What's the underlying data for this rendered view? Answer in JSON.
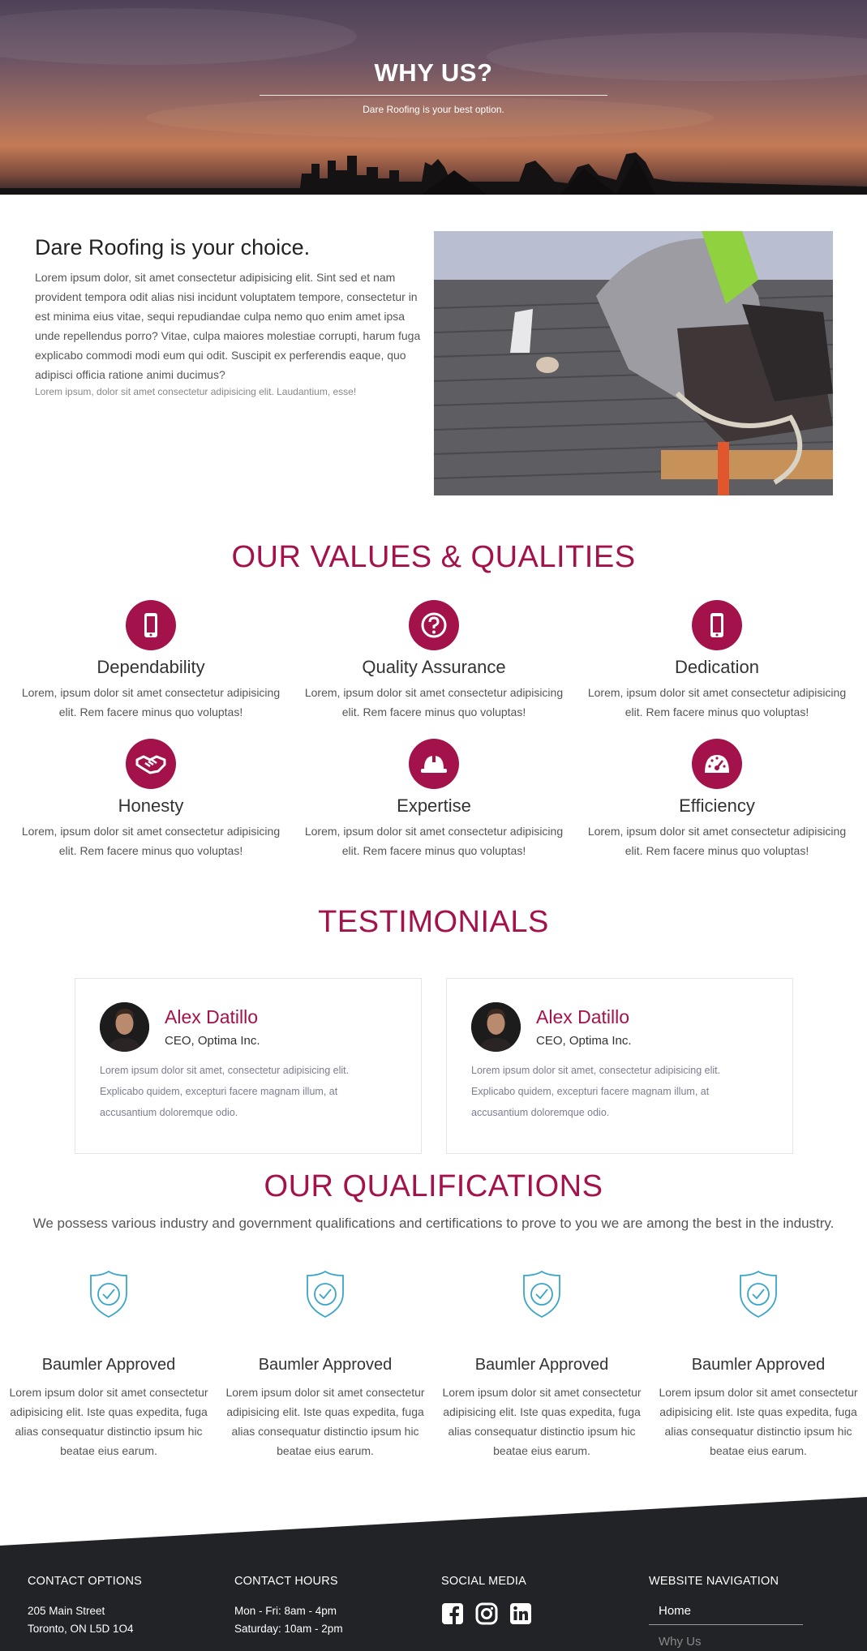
{
  "hero": {
    "title": "WHY US?",
    "subtitle": "Dare Roofing is your best option."
  },
  "choice": {
    "title": "Dare Roofing is your choice.",
    "text": "Lorem ipsum dolor, sit amet consectetur adipisicing elit. Sint sed et nam provident tempora odit alias nisi incidunt voluptatem tempore, consectetur in est minima eius vitae, sequi repudiandae culpa nemo quo enim amet ipsa unde repellendus porro? Vitae, culpa maiores molestiae corrupti, harum fuga explicabo commodi modi eum qui odit. Suscipit ex perferendis eaque, quo adipisci officia ratione animi ducimus?",
    "small": "Lorem ipsum, dolor sit amet consectetur adipisicing elit. Laudantium, esse!"
  },
  "values": {
    "title": "OUR VALUES & QUALITIES",
    "items": [
      {
        "icon": "mobile-phone-icon",
        "title": "Dependability",
        "text": "Lorem, ipsum dolor sit amet consectetur adipisicing elit. Rem facere minus quo voluptas!"
      },
      {
        "icon": "question-circle-icon",
        "title": "Quality Assurance",
        "text": "Lorem, ipsum dolor sit amet consectetur adipisicing elit. Rem facere minus quo voluptas!"
      },
      {
        "icon": "mobile-phone-icon",
        "title": "Dedication",
        "text": "Lorem, ipsum dolor sit amet consectetur adipisicing elit. Rem facere minus quo voluptas!"
      },
      {
        "icon": "handshake-icon",
        "title": "Honesty",
        "text": "Lorem, ipsum dolor sit amet consectetur adipisicing elit. Rem facere minus quo voluptas!"
      },
      {
        "icon": "hard-hat-icon",
        "title": "Expertise",
        "text": "Lorem, ipsum dolor sit amet consectetur adipisicing elit. Rem facere minus quo voluptas!"
      },
      {
        "icon": "speedometer-icon",
        "title": "Efficiency",
        "text": "Lorem, ipsum dolor sit amet consectetur adipisicing elit. Rem facere minus quo voluptas!"
      }
    ]
  },
  "testimonials": {
    "title": "TESTIMONIALS",
    "items": [
      {
        "name": "Alex Datillo",
        "role": "CEO, Optima Inc.",
        "text": "Lorem ipsum dolor sit amet, consectetur adipisicing elit. Explicabo quidem, excepturi facere magnam illum, at accusantium doloremque odio."
      },
      {
        "name": "Alex Datillo",
        "role": "CEO, Optima Inc.",
        "text": "Lorem ipsum dolor sit amet, consectetur adipisicing elit. Explicabo quidem, excepturi facere magnam illum, at accusantium doloremque odio."
      }
    ]
  },
  "qualifications": {
    "title": "OUR QUALIFICATIONS",
    "intro": "We possess various industry and government qualifications and certifications to prove to you we are among the best in the industry.",
    "items": [
      {
        "title": "Baumler Approved",
        "text": "Lorem ipsum dolor sit amet consectetur adipisicing elit. Iste quas expedita, fuga alias consequatur distinctio ipsum hic beatae eius earum."
      },
      {
        "title": "Baumler Approved",
        "text": "Lorem ipsum dolor sit amet consectetur adipisicing elit. Iste quas expedita, fuga alias consequatur distinctio ipsum hic beatae eius earum."
      },
      {
        "title": "Baumler Approved",
        "text": "Lorem ipsum dolor sit amet consectetur adipisicing elit. Iste quas expedita, fuga alias consequatur distinctio ipsum hic beatae eius earum."
      },
      {
        "title": "Baumler Approved",
        "text": "Lorem ipsum dolor sit amet consectetur adipisicing elit. Iste quas expedita, fuga alias consequatur distinctio ipsum hic beatae eius earum."
      }
    ]
  },
  "footer": {
    "contact_options": {
      "heading": "CONTACT OPTIONS",
      "address1": "205 Main Street",
      "address2": "Toronto, ON L5D 1O4"
    },
    "contact_hours": {
      "heading": "CONTACT HOURS",
      "line1": "Mon - Fri: 8am - 4pm",
      "line2": "Saturday: 10am - 2pm"
    },
    "social": {
      "heading": "SOCIAL MEDIA",
      "icons": [
        "facebook-icon",
        "instagram-icon",
        "linkedin-icon"
      ]
    },
    "navigation": {
      "heading": "WEBSITE NAVIGATION",
      "items": [
        "Home",
        "Why Us"
      ]
    }
  },
  "colors": {
    "accent": "#a3124a",
    "footer_bg": "#212327",
    "shield": "#3aa5c9"
  }
}
